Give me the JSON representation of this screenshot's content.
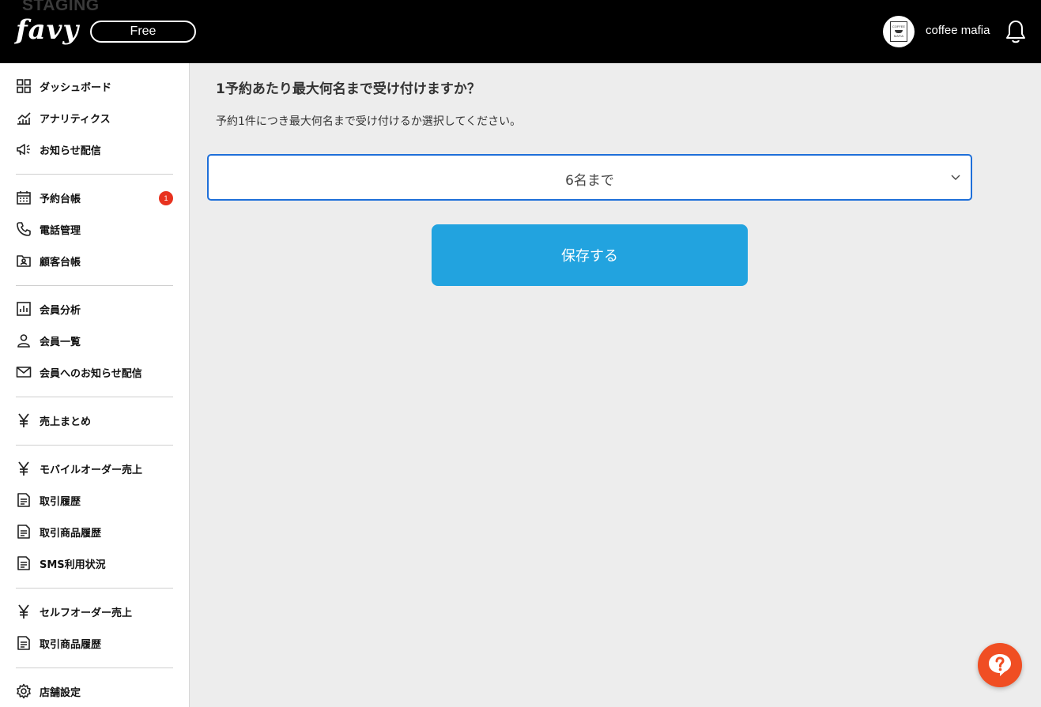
{
  "header": {
    "environment_label": "STAGING",
    "logo_text": "favy",
    "plan_badge": "Free",
    "store_name": "coffee mafia",
    "avatar_text": [
      "COFFEE",
      "MAFIA"
    ]
  },
  "sidebar": {
    "groups": [
      {
        "items": [
          {
            "label": "ダッシュボード",
            "icon": "dashboard-icon"
          },
          {
            "label": "アナリティクス",
            "icon": "analytics-icon"
          },
          {
            "label": "お知らせ配信",
            "icon": "megaphone-icon"
          }
        ]
      },
      {
        "items": [
          {
            "label": "予約台帳",
            "icon": "calendar-icon",
            "badge": "1"
          },
          {
            "label": "電話管理",
            "icon": "phone-icon"
          },
          {
            "label": "顧客台帳",
            "icon": "customer-ledger-icon"
          }
        ]
      },
      {
        "items": [
          {
            "label": "会員分析",
            "icon": "member-analysis-icon"
          },
          {
            "label": "会員一覧",
            "icon": "person-icon"
          },
          {
            "label": "会員へのお知らせ配信",
            "icon": "mail-icon"
          }
        ]
      },
      {
        "items": [
          {
            "label": "売上まとめ",
            "icon": "yen-icon"
          }
        ]
      },
      {
        "items": [
          {
            "label": "モバイルオーダー売上",
            "icon": "yen-icon"
          },
          {
            "label": "取引履歴",
            "icon": "document-icon"
          },
          {
            "label": "取引商品履歴",
            "icon": "document-icon"
          },
          {
            "label": "SMS利用状況",
            "icon": "document-icon"
          }
        ]
      },
      {
        "items": [
          {
            "label": "セルフオーダー売上",
            "icon": "yen-icon"
          },
          {
            "label": "取引商品履歴",
            "icon": "document-icon"
          }
        ]
      },
      {
        "items": [
          {
            "label": "店舗設定",
            "icon": "gear-icon"
          }
        ]
      }
    ]
  },
  "main": {
    "question": "1予約あたり最大何名まで受け付けますか？",
    "description": "予約1件につき最大何名まで受け付けるか選択してください。",
    "select": {
      "selected": "6名まで"
    },
    "save_label": "保存する"
  },
  "colors": {
    "header_bg": "#000000",
    "accent_blue": "#22a3df",
    "select_border": "#1e6fd9",
    "badge_red": "#e8321f",
    "help_orange": "#f04e23"
  }
}
